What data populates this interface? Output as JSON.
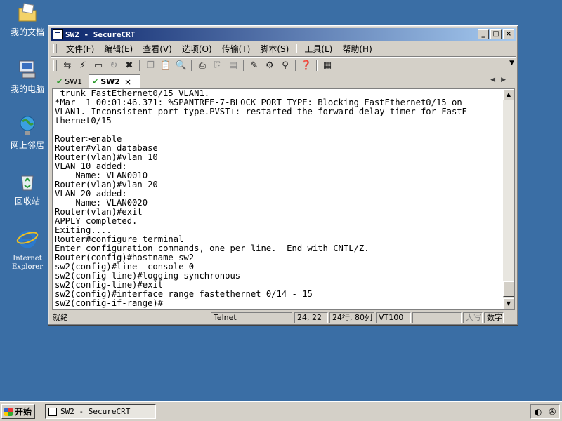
{
  "desktop": {
    "icons": [
      {
        "label": "我的文档"
      },
      {
        "label": "我的电脑"
      },
      {
        "label": "网上邻居"
      },
      {
        "label": "回收站"
      },
      {
        "label_line1": "Internet",
        "label_line2": "Explorer"
      }
    ]
  },
  "window": {
    "title": "SW2 - SecureCRT",
    "min_glyph": "_",
    "max_glyph": "□",
    "close_glyph": "×"
  },
  "menu": {
    "file": "文件(F)",
    "edit": "编辑(E)",
    "view": "查看(V)",
    "options": "选项(O)",
    "transfer": "传输(T)",
    "script": "脚本(S)",
    "tools": "工具(L)",
    "help": "帮助(H)"
  },
  "tabs": [
    {
      "label": "SW1"
    },
    {
      "label": "SW2",
      "close": "×"
    }
  ],
  "terminal": {
    "lines": " trunk FastEthernet0/15 VLAN1.\n*Mar  1 00:01:46.371: %SPANTREE-7-BLOCK_PORT_TYPE: Blocking FastEthernet0/15 on\nVLAN1. Inconsistent port type.PVST+: restarted the forward delay timer for FastE\nthernet0/15\n\nRouter>enable\nRouter#vlan database\nRouter(vlan)#vlan 10\nVLAN 10 added:\n    Name: VLAN0010\nRouter(vlan)#vlan 20\nVLAN 20 added:\n    Name: VLAN0020\nRouter(vlan)#exit\nAPPLY completed.\nExiting....\nRouter#configure terminal\nEnter configuration commands, one per line.  End with CNTL/Z.\nRouter(config)#hostname sw2\nsw2(config)#line  console 0\nsw2(config-line)#logging synchronous\nsw2(config-line)#exit\nsw2(config)#interface range fastethernet 0/14 - 15\nsw2(config-if-range)#"
  },
  "status": {
    "ready": "就绪",
    "protocol": "Telnet",
    "cursor": "24, 22",
    "size": "24行, 80列",
    "emulation": "VT100",
    "caps": "大写",
    "num": "数字"
  },
  "taskbar": {
    "start": "开始",
    "task": "SW2 - SecureCRT"
  }
}
